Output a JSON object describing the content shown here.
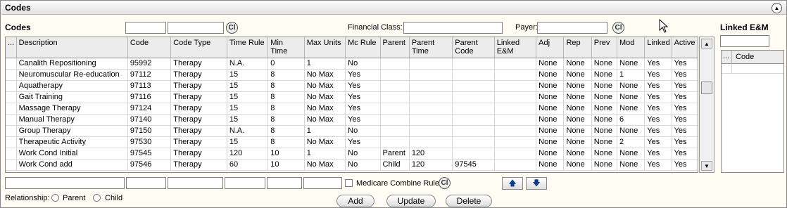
{
  "panel": {
    "title": "Codes",
    "collapse_icon": "circle-up-arrow-icon"
  },
  "filters": {
    "codes_label": "Codes",
    "code_value_1": "",
    "code_value_2": "",
    "clear_label": "Cl",
    "financial_class_label": "Financial Class:",
    "financial_class_value": "",
    "payer_label": "Payer:",
    "payer_value": ""
  },
  "grid": {
    "columns": [
      "...",
      "Description",
      "Code",
      "Code Type",
      "Time Rule",
      "Min Time",
      "Max Units",
      "Mc Rule",
      "Parent",
      "Parent Time",
      "Parent Code",
      "Linked E&M",
      "Adj",
      "Rep",
      "Prev",
      "Mod",
      "Linked",
      "Active"
    ],
    "rows": [
      [
        "",
        "Canalith Repositioning",
        "95992",
        "Therapy",
        "N.A.",
        "0",
        "1",
        "No",
        "",
        "",
        "",
        "",
        "None",
        "None",
        "None",
        "None",
        "Yes",
        "Yes"
      ],
      [
        "",
        "Neuromuscular Re-education",
        "97112",
        "Therapy",
        "15",
        "8",
        "No Max",
        "Yes",
        "",
        "",
        "",
        "",
        "None",
        "None",
        "None",
        "1",
        "Yes",
        "Yes"
      ],
      [
        "",
        "Aquatherapy",
        "97113",
        "Therapy",
        "15",
        "8",
        "No Max",
        "Yes",
        "",
        "",
        "",
        "",
        "None",
        "None",
        "None",
        "None",
        "Yes",
        "Yes"
      ],
      [
        "",
        "Gait Training",
        "97116",
        "Therapy",
        "15",
        "8",
        "No Max",
        "Yes",
        "",
        "",
        "",
        "",
        "None",
        "None",
        "None",
        "None",
        "Yes",
        "Yes"
      ],
      [
        "",
        "Massage Therapy",
        "97124",
        "Therapy",
        "15",
        "8",
        "No Max",
        "Yes",
        "",
        "",
        "",
        "",
        "None",
        "None",
        "None",
        "None",
        "Yes",
        "Yes"
      ],
      [
        "",
        "Manual Therapy",
        "97140",
        "Therapy",
        "15",
        "8",
        "No Max",
        "Yes",
        "",
        "",
        "",
        "",
        "None",
        "None",
        "None",
        "6",
        "Yes",
        "Yes"
      ],
      [
        "",
        "Group Therapy",
        "97150",
        "Therapy",
        "N.A.",
        "8",
        "1",
        "No",
        "",
        "",
        "",
        "",
        "None",
        "None",
        "None",
        "None",
        "Yes",
        "Yes"
      ],
      [
        "",
        "Therapeutic Activity",
        "97530",
        "Therapy",
        "15",
        "8",
        "No Max",
        "Yes",
        "",
        "",
        "",
        "",
        "None",
        "None",
        "None",
        "2",
        "Yes",
        "Yes"
      ],
      [
        "",
        "Work Cond Initial",
        "97545",
        "Therapy",
        "120",
        "10",
        "1",
        "No",
        "Parent",
        "120",
        "",
        "",
        "None",
        "None",
        "None",
        "None",
        "Yes",
        "Yes"
      ],
      [
        "",
        "Work Cond add",
        "97546",
        "Therapy",
        "60",
        "10",
        "No Max",
        "No",
        "Child",
        "120",
        "97545",
        "",
        "None",
        "None",
        "None",
        "None",
        "Yes",
        "Yes"
      ]
    ]
  },
  "linked_em": {
    "title": "Linked E&M",
    "search_value": "",
    "columns": [
      "...",
      "Code"
    ]
  },
  "editor": {
    "medicare_combine_label": "Medicare Combine Rule",
    "medicare_combine_checked": false,
    "clear_label": "Cl",
    "move_up_icon": "arrow-up-icon",
    "move_down_icon": "arrow-down-icon",
    "relationship_label": "Relationship:",
    "parent_label": "Parent",
    "child_label": "Child",
    "add_label": "Add",
    "update_label": "Update",
    "delete_label": "Delete"
  }
}
